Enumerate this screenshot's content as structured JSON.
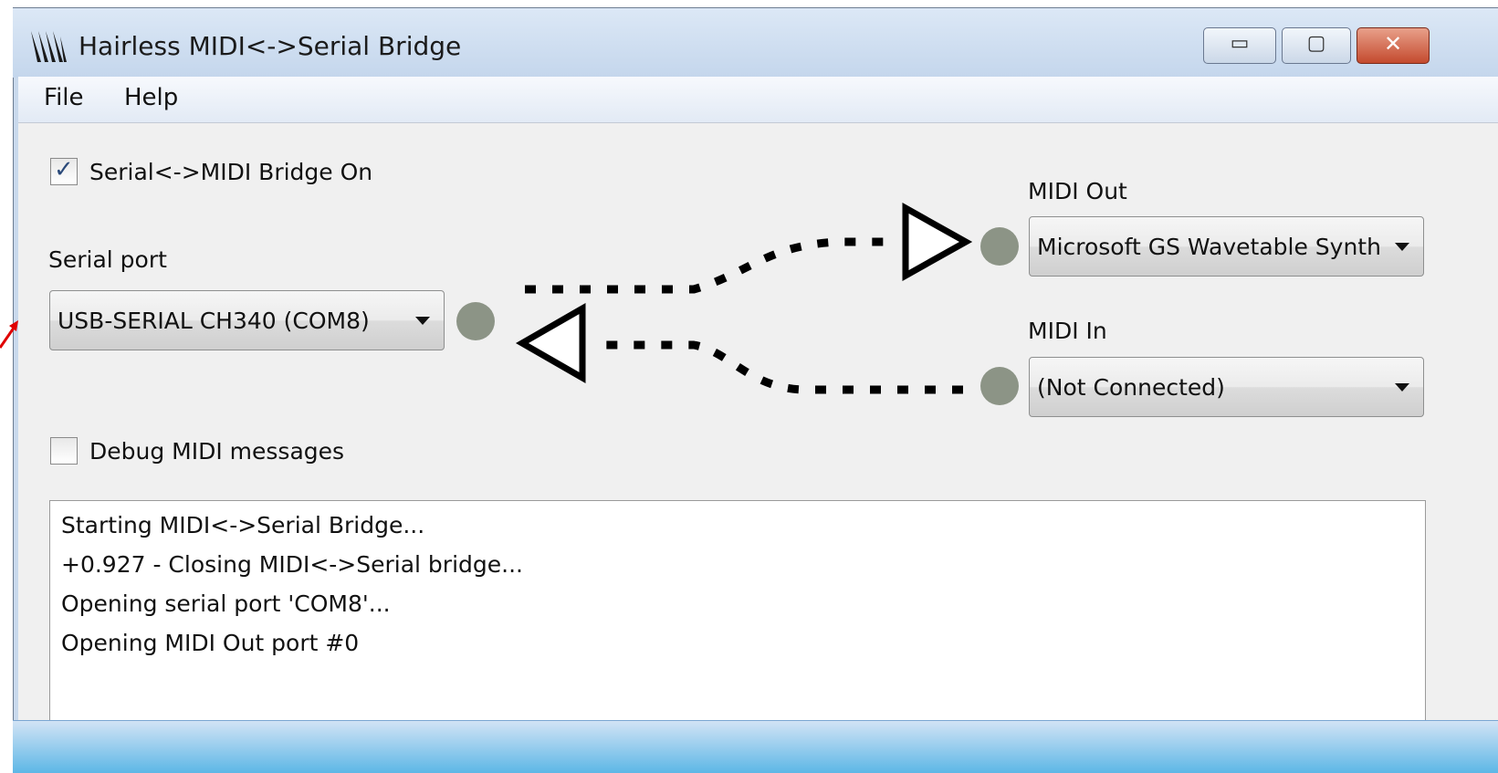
{
  "window": {
    "title": "Hairless MIDI<->Serial Bridge",
    "buttons": {
      "minimize": "▭",
      "maximize": "▢",
      "close": "✕"
    }
  },
  "menu": {
    "items": [
      "File",
      "Help"
    ]
  },
  "bridge": {
    "label": "Serial<->MIDI Bridge On",
    "checked": true
  },
  "serial": {
    "label": "Serial port",
    "selected": "USB-SERIAL CH340 (COM8)"
  },
  "midi_out": {
    "label": "MIDI Out",
    "selected": "Microsoft GS Wavetable Synth"
  },
  "midi_in": {
    "label": "MIDI In",
    "selected": "(Not Connected)"
  },
  "debug": {
    "label": "Debug MIDI messages",
    "checked": false
  },
  "log": {
    "lines": [
      "Starting MIDI<->Serial Bridge...",
      "+0.927 - Closing MIDI<->Serial bridge...",
      "Opening serial port 'COM8'...",
      "Opening MIDI Out port #0"
    ]
  },
  "colors": {
    "led_idle": "#8c9486",
    "flow_lines": "#000000",
    "annotation_arrow": "#e00000"
  }
}
